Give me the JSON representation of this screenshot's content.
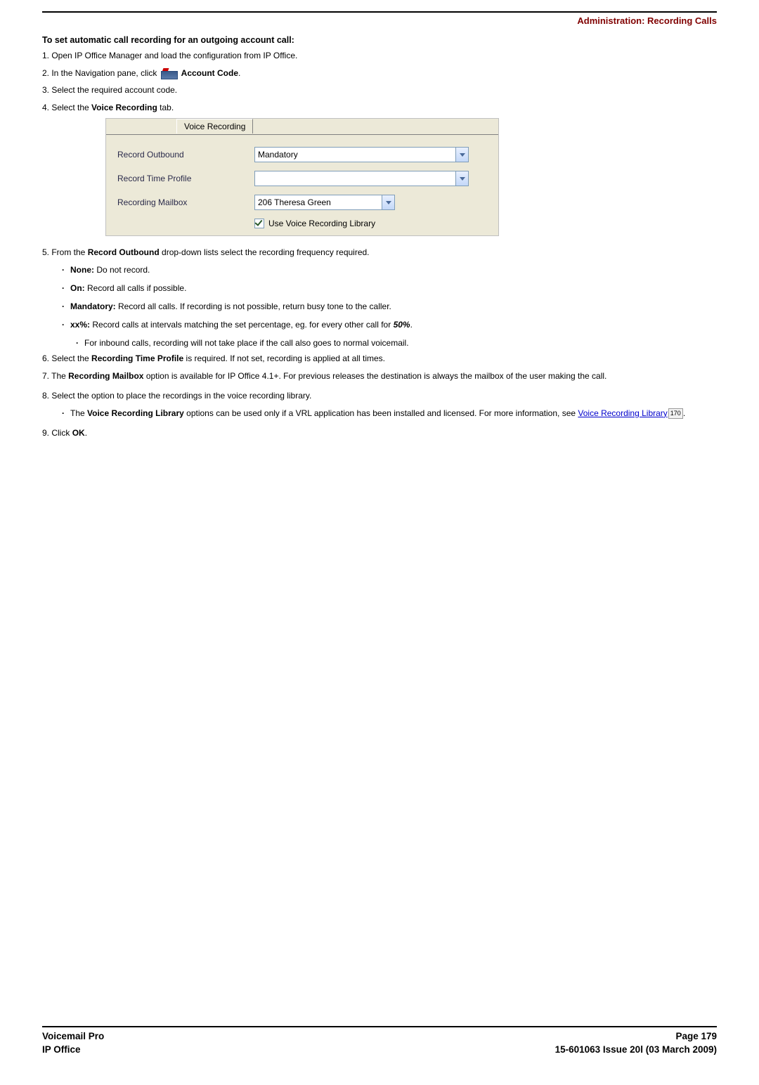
{
  "header": {
    "breadcrumb": "Administration: Recording Calls"
  },
  "section_title": "To set automatic call recording for an outgoing account call:",
  "steps": {
    "s1": "1. Open IP Office Manager and load the configuration from IP Office.",
    "s2a": "2. In the Navigation pane, click ",
    "s2b": " Account Code",
    "s2c": ".",
    "s3": "3. Select the required account code.",
    "s4a": "4. Select the ",
    "s4b": "Voice Recording",
    "s4c": " tab.",
    "s5a": "5. From the ",
    "s5b": "Record Outbound",
    "s5c": " drop-down lists select the recording frequency required.",
    "s6a": "6. Select the ",
    "s6b": "Recording Time Profile",
    "s6c": " is required. If not set, recording is applied at all times.",
    "s7a": "7. The ",
    "s7b": "Recording Mailbox",
    "s7c": " option is available for IP Office 4.1+. For previous releases the destination is always the mailbox of the user making the call.",
    "s8": "8. Select the option to place the recordings in the voice recording library.",
    "s9a": "9. Click ",
    "s9b": "OK",
    "s9c": "."
  },
  "bullets5": {
    "b1a": "None:",
    "b1b": " Do not record.",
    "b2a": "On:",
    "b2b": " Record all calls if possible.",
    "b3a": "Mandatory:",
    "b3b": " Record all calls. If recording is not possible, return busy tone to the caller.",
    "b4a": "xx%:",
    "b4b": " Record calls at intervals matching the set percentage, eg. for every other call for ",
    "b4c": "50%",
    "b4d": ".",
    "b4sub": "For inbound calls, recording will not take place if the call also goes to normal voicemail."
  },
  "bullets8": {
    "b1a": "The ",
    "b1b": "Voice Recording Library",
    "b1c": " options can be used only if a VRL application has been installed and licensed. For more information, see ",
    "b1link": "Voice Recording Library",
    "b1ref": "170",
    "b1d": "."
  },
  "panel": {
    "tab": "Voice Recording",
    "row1_label": "Record Outbound",
    "row1_value": "Mandatory",
    "row2_label": "Record Time Profile",
    "row2_value": "",
    "row3_label": "Recording Mailbox",
    "row3_value": "206 Theresa Green",
    "check_label": "Use Voice Recording Library"
  },
  "footer": {
    "left1": "Voicemail Pro",
    "left2": "IP Office",
    "right1": "Page 179",
    "right2": "15-601063 Issue 20l (03 March 2009)"
  }
}
